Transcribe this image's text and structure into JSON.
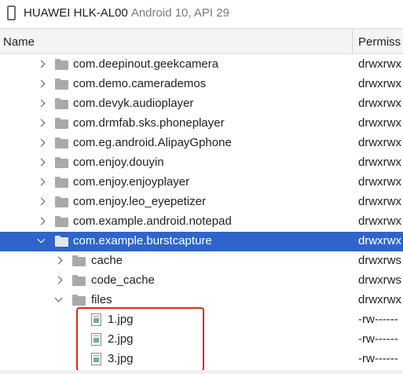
{
  "device": {
    "name": "HUAWEI HLK-AL00",
    "details": "Android 10, API 29",
    "icon": "phone-icon"
  },
  "columns": {
    "name": "Name",
    "permissions": "Permiss"
  },
  "colors": {
    "selection": "#2f65ca",
    "highlight_box": "#e0241b",
    "folder": "#a9a9a9"
  },
  "rows": [
    {
      "label": "com.deepinout.geekcamera",
      "perm": "drwxrwx",
      "type": "folder",
      "expand": "collapsed",
      "level": 1,
      "selected": false
    },
    {
      "label": "com.demo.camerademos",
      "perm": "drwxrwx",
      "type": "folder",
      "expand": "collapsed",
      "level": 1,
      "selected": false
    },
    {
      "label": "com.devyk.audioplayer",
      "perm": "drwxrwx",
      "type": "folder",
      "expand": "collapsed",
      "level": 1,
      "selected": false
    },
    {
      "label": "com.drmfab.sks.phoneplayer",
      "perm": "drwxrwx",
      "type": "folder",
      "expand": "collapsed",
      "level": 1,
      "selected": false
    },
    {
      "label": "com.eg.android.AlipayGphone",
      "perm": "drwxrwx",
      "type": "folder",
      "expand": "collapsed",
      "level": 1,
      "selected": false
    },
    {
      "label": "com.enjoy.douyin",
      "perm": "drwxrwx",
      "type": "folder",
      "expand": "collapsed",
      "level": 1,
      "selected": false
    },
    {
      "label": "com.enjoy.enjoyplayer",
      "perm": "drwxrwx",
      "type": "folder",
      "expand": "collapsed",
      "level": 1,
      "selected": false
    },
    {
      "label": "com.enjoy.leo_eyepetizer",
      "perm": "drwxrwx",
      "type": "folder",
      "expand": "collapsed",
      "level": 1,
      "selected": false
    },
    {
      "label": "com.example.android.notepad",
      "perm": "drwxrwx",
      "type": "folder",
      "expand": "collapsed",
      "level": 1,
      "selected": false
    },
    {
      "label": "com.example.burstcapture",
      "perm": "drwxrwx",
      "type": "folder",
      "expand": "expanded",
      "level": 1,
      "selected": true
    },
    {
      "label": "cache",
      "perm": "drwxrws",
      "type": "folder",
      "expand": "collapsed",
      "level": 2,
      "selected": false
    },
    {
      "label": "code_cache",
      "perm": "drwxrws",
      "type": "folder",
      "expand": "collapsed",
      "level": 2,
      "selected": false
    },
    {
      "label": "files",
      "perm": "drwxrwx",
      "type": "folder",
      "expand": "expanded",
      "level": 2,
      "selected": false
    },
    {
      "label": "1.jpg",
      "perm": "-rw------",
      "type": "file",
      "expand": "none",
      "level": 3,
      "selected": false
    },
    {
      "label": "2.jpg",
      "perm": "-rw------",
      "type": "file",
      "expand": "none",
      "level": 3,
      "selected": false
    },
    {
      "label": "3.jpg",
      "perm": "-rw------",
      "type": "file",
      "expand": "none",
      "level": 3,
      "selected": false
    }
  ]
}
